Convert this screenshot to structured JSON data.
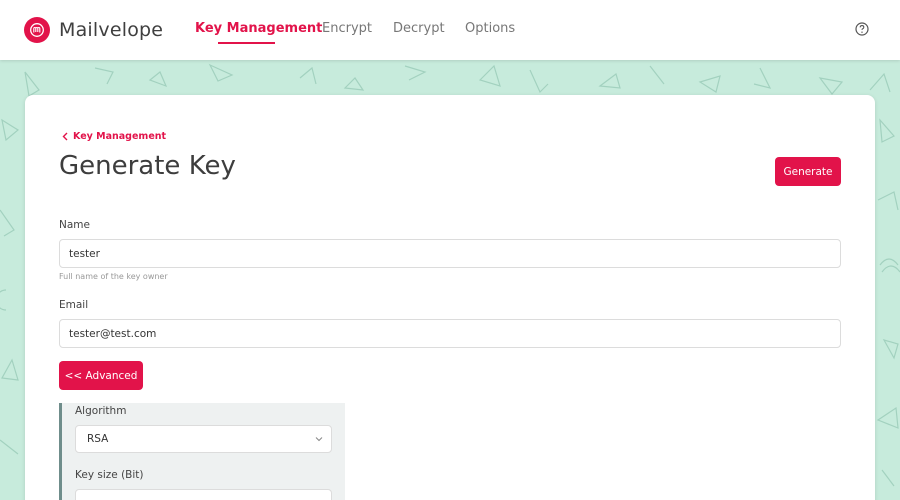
{
  "app": {
    "name": "Mailvelope",
    "logo_icon": "mailvelope-logo-icon",
    "accent_color": "#e2134a",
    "background_color": "#c7ebdc"
  },
  "nav": {
    "items": [
      {
        "label": "Key Management",
        "active": true
      },
      {
        "label": "Encrypt",
        "active": false
      },
      {
        "label": "Decrypt",
        "active": false
      },
      {
        "label": "Options",
        "active": false
      }
    ],
    "help_icon": "help-circle-icon"
  },
  "page": {
    "back_link": "Key Management",
    "title": "Generate Key",
    "generate_button": "Generate"
  },
  "form": {
    "name_label": "Name",
    "name_value": "tester",
    "name_hint": "Full name of the key owner",
    "email_label": "Email",
    "email_value": "tester@test.com",
    "advanced_button": "<< Advanced"
  },
  "advanced": {
    "algorithm_label": "Algorithm",
    "algorithm_value": "RSA",
    "keysize_label": "Key size (Bit)",
    "keysize_value": ""
  }
}
